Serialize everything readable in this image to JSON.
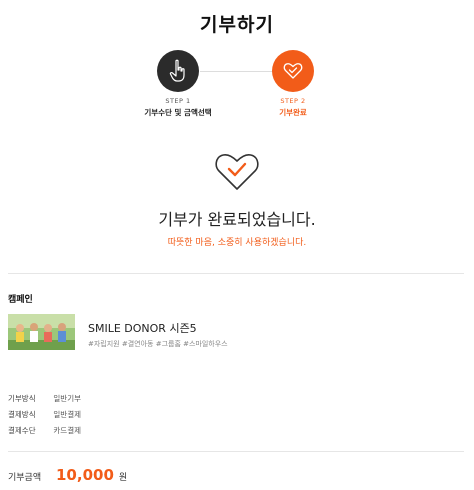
{
  "page": {
    "title": "기부하기"
  },
  "stepper": {
    "steps": [
      {
        "num": "STEP 1",
        "label": "기부수단 및 금액선택",
        "icon": "hand-pointer-icon",
        "state": "done"
      },
      {
        "num": "STEP 2",
        "label": "기부완료",
        "icon": "heart-check-icon",
        "state": "current"
      }
    ]
  },
  "result": {
    "icon": "heart-check-icon",
    "title": "기부가 완료되었습니다.",
    "subtitle": "따뜻한 마음, 소중히 사용하겠습니다."
  },
  "campaign": {
    "section_label": "캠페인",
    "title": "SMILE DONOR 시즌5",
    "tags": "#자립지원 #결연아동 #그룹홈 #스마일하우스"
  },
  "details": [
    {
      "key": "기부방식",
      "value": "일반기부"
    },
    {
      "key": "결제방식",
      "value": "일반결제"
    },
    {
      "key": "결제수단",
      "value": "카드결제"
    }
  ],
  "amount": {
    "key": "기부금액",
    "value": "10,000",
    "unit": "원"
  },
  "colors": {
    "accent": "#f25c19",
    "dark": "#2b2b2b",
    "divider": "#e6e6e6"
  }
}
